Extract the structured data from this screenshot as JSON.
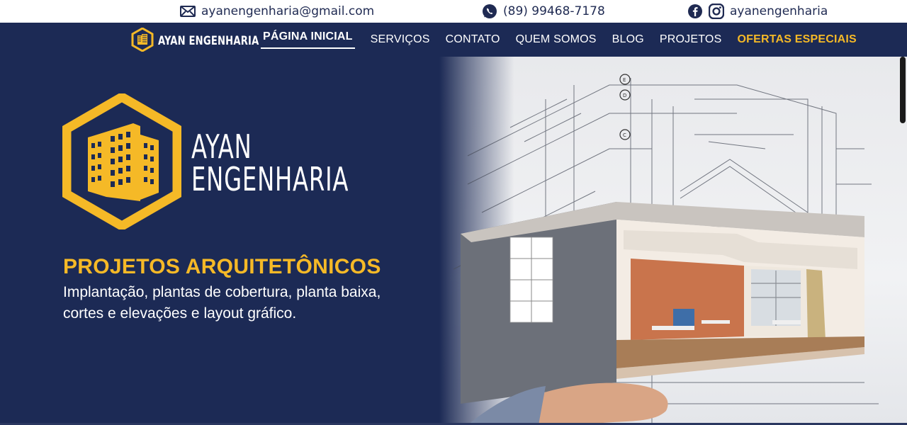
{
  "topbar": {
    "email": "ayanengenharia@gmail.com",
    "phone": "(89) 99468-7178",
    "social_handle": "ayanengenharia",
    "icons": [
      "mail-icon",
      "whatsapp-icon",
      "facebook-icon",
      "instagram-icon"
    ]
  },
  "nav": {
    "brand": "AYAN ENGENHARIA",
    "links": [
      {
        "label": "PÁGINA INICIAL",
        "active": true
      },
      {
        "label": "SERVIÇOS"
      },
      {
        "label": "CONTATO"
      },
      {
        "label": "QUEM SOMOS"
      },
      {
        "label": "BLOG"
      },
      {
        "label": "PROJETOS"
      },
      {
        "label": "OFERTAS ESPECIAIS",
        "highlight": true
      }
    ]
  },
  "hero": {
    "logo_line1": "AYAN",
    "logo_line2": "ENGENHARIA",
    "title": "PROJETOS ARQUITETÔNICOS",
    "description": "Implantação, plantas de cobertura, planta baixa, cortes e elevações e layout gráfico."
  },
  "colors": {
    "navy": "#1c2a55",
    "accent": "#f5b927",
    "white": "#ffffff"
  }
}
